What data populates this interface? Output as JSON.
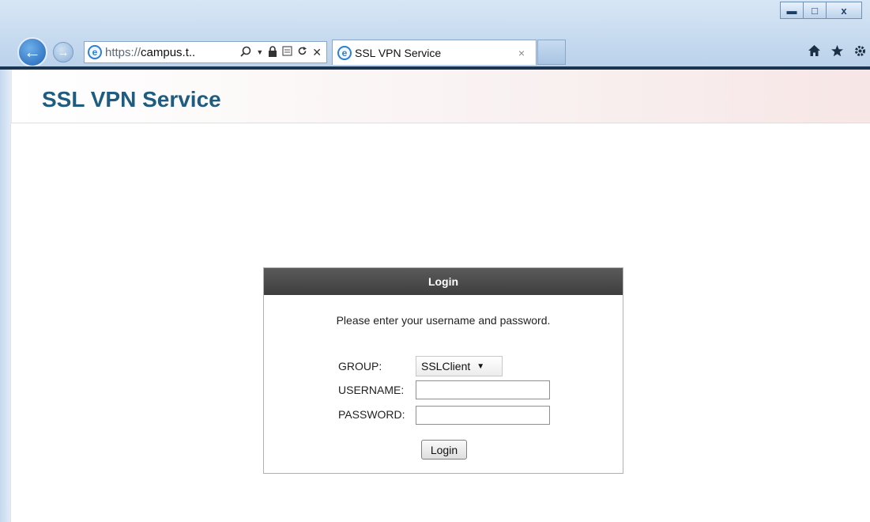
{
  "window": {
    "minimize": "▬",
    "maximize": "□",
    "close": "x"
  },
  "browser": {
    "back_glyph": "←",
    "forward_glyph": "→",
    "address": {
      "scheme": "https://",
      "host": "campus.t..",
      "icons": [
        "search-icon",
        "dropdown-icon",
        "lock-icon",
        "compat-icon",
        "refresh-icon",
        "stop-icon"
      ]
    },
    "tab": {
      "title": "SSL VPN Service",
      "close": "×"
    },
    "toolbar_icons": [
      "home-icon",
      "favorites-icon",
      "settings-icon"
    ]
  },
  "page": {
    "title": "SSL VPN Service"
  },
  "login": {
    "heading": "Login",
    "message": "Please enter your username and password.",
    "group_label": "GROUP:",
    "group_value": "SSLClient",
    "username_label": "USERNAME:",
    "username_value": "",
    "password_label": "PASSWORD:",
    "password_value": "",
    "button_label": "Login"
  }
}
